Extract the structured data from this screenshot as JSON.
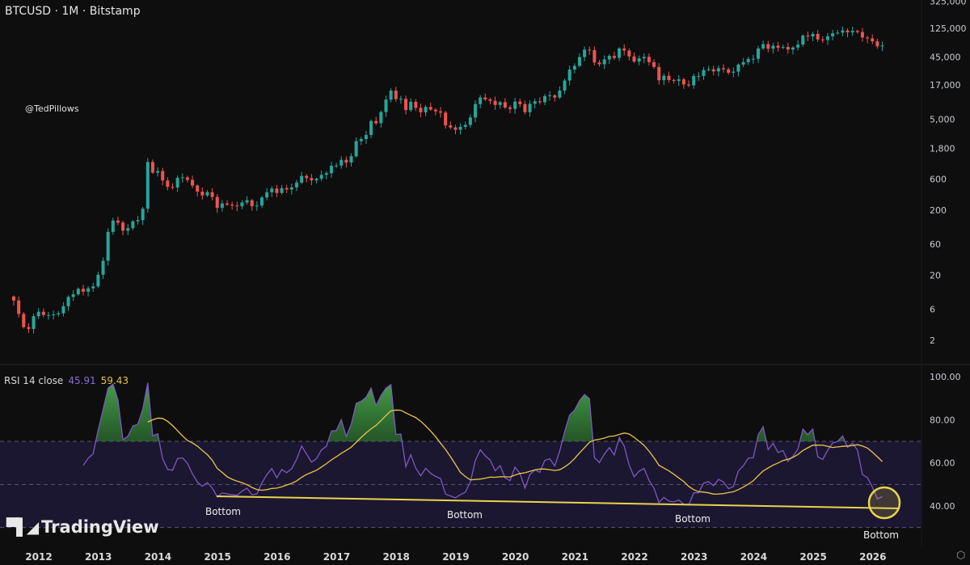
{
  "header": {
    "title": "BTCUSD · 1M · Bitstamp",
    "watermark_handle": "@TedPillows"
  },
  "rsi_legend": {
    "label": "RSI 14 close",
    "rsi_value": "45.91",
    "ma_value": "59.43"
  },
  "logo": {
    "text": "TradingView",
    "mark": "17"
  },
  "annotations": {
    "bottom_labels": [
      "Bottom",
      "Bottom",
      "Bottom",
      "Bottom"
    ]
  },
  "colors": {
    "up": "#26a69a",
    "down": "#ef5350",
    "rsi": "#7e57c2",
    "rsi_ma": "#e8c547",
    "band": "#1b1730",
    "trendline": "#e8d44d"
  },
  "settings_icon": "settings-icon",
  "chart_data": [
    {
      "type": "candlestick",
      "title": "BTCUSD · 1M · Bitstamp",
      "yscale": "log",
      "start_month": "2011-08",
      "closes": [
        8.2,
        5.1,
        3.2,
        3.0,
        4.7,
        5.5,
        4.9,
        4.9,
        5.0,
        5.2,
        6.7,
        9.3,
        10.2,
        12.4,
        11.2,
        12.6,
        13.5,
        20.4,
        33.4,
        93,
        139,
        129,
        97,
        106,
        135,
        141,
        211,
        1100,
        755,
        800,
        573,
        457,
        447,
        628,
        640,
        586,
        478,
        386,
        338,
        378,
        320,
        217,
        254,
        244,
        236,
        230,
        263,
        284,
        230,
        236,
        314,
        378,
        430,
        368,
        437,
        416,
        448,
        531,
        673,
        624,
        575,
        609,
        700,
        742,
        963,
        970,
        1190,
        1080,
        1350,
        2300,
        2480,
        2870,
        4700,
        4340,
        6450,
        10000,
        13800,
        10200,
        10300,
        6930,
        9240,
        7500,
        6400,
        7730,
        7030,
        6620,
        6320,
        4020,
        3740,
        3440,
        3820,
        4100,
        5320,
        8570,
        10800,
        10100,
        9600,
        8300,
        9150,
        7570,
        7200,
        9350,
        8540,
        6420,
        8630,
        9450,
        9140,
        11350,
        11650,
        10780,
        13800,
        19700,
        29000,
        33100,
        45200,
        58800,
        57700,
        37300,
        35000,
        41500,
        47100,
        43800,
        61300,
        57000,
        46200,
        38500,
        43200,
        45500,
        37700,
        31800,
        19900,
        23300,
        20050,
        19400,
        20500,
        17150,
        16550,
        23100,
        23150,
        28500,
        29250,
        27200,
        30450,
        29250,
        25950,
        26950,
        34650,
        37700,
        42300,
        42600,
        61200,
        71300,
        60600,
        67500,
        62700,
        64600,
        58900,
        63300,
        70200,
        96400,
        93400,
        102400,
        84300,
        82500,
        94200,
        104600,
        107100,
        115700,
        108200,
        114000,
        109500,
        90400,
        87500,
        78700,
        66000,
        68000
      ],
      "y_ticks": [
        "325,000",
        "125,000",
        "45,000",
        "17,000",
        "5,000",
        "1,800",
        "600",
        "200",
        "60",
        "20",
        "6",
        "2"
      ],
      "y_tick_values": [
        325000,
        125000,
        45000,
        17000,
        5000,
        1800,
        600,
        200,
        60,
        20,
        6,
        2
      ],
      "x_ticks": [
        "2012",
        "2013",
        "2014",
        "2015",
        "2016",
        "2017",
        "2018",
        "2019",
        "2020",
        "2021",
        "2022",
        "2023",
        "2024",
        "2025",
        "2026"
      ]
    },
    {
      "type": "line",
      "title": "RSI 14 close",
      "series": [
        {
          "name": "RSI 14",
          "derived_from": "closes",
          "period": 14
        },
        {
          "name": "RSI MA",
          "derived_from": "RSI",
          "period": 14
        }
      ],
      "ylim": [
        30,
        100
      ],
      "y_ticks": [
        "100.00",
        "80.00",
        "60.00",
        "40.00"
      ],
      "y_tick_values": [
        100,
        80,
        60,
        40
      ],
      "bands": [
        70,
        50,
        30
      ],
      "trendline_label": "Bottom"
    }
  ]
}
